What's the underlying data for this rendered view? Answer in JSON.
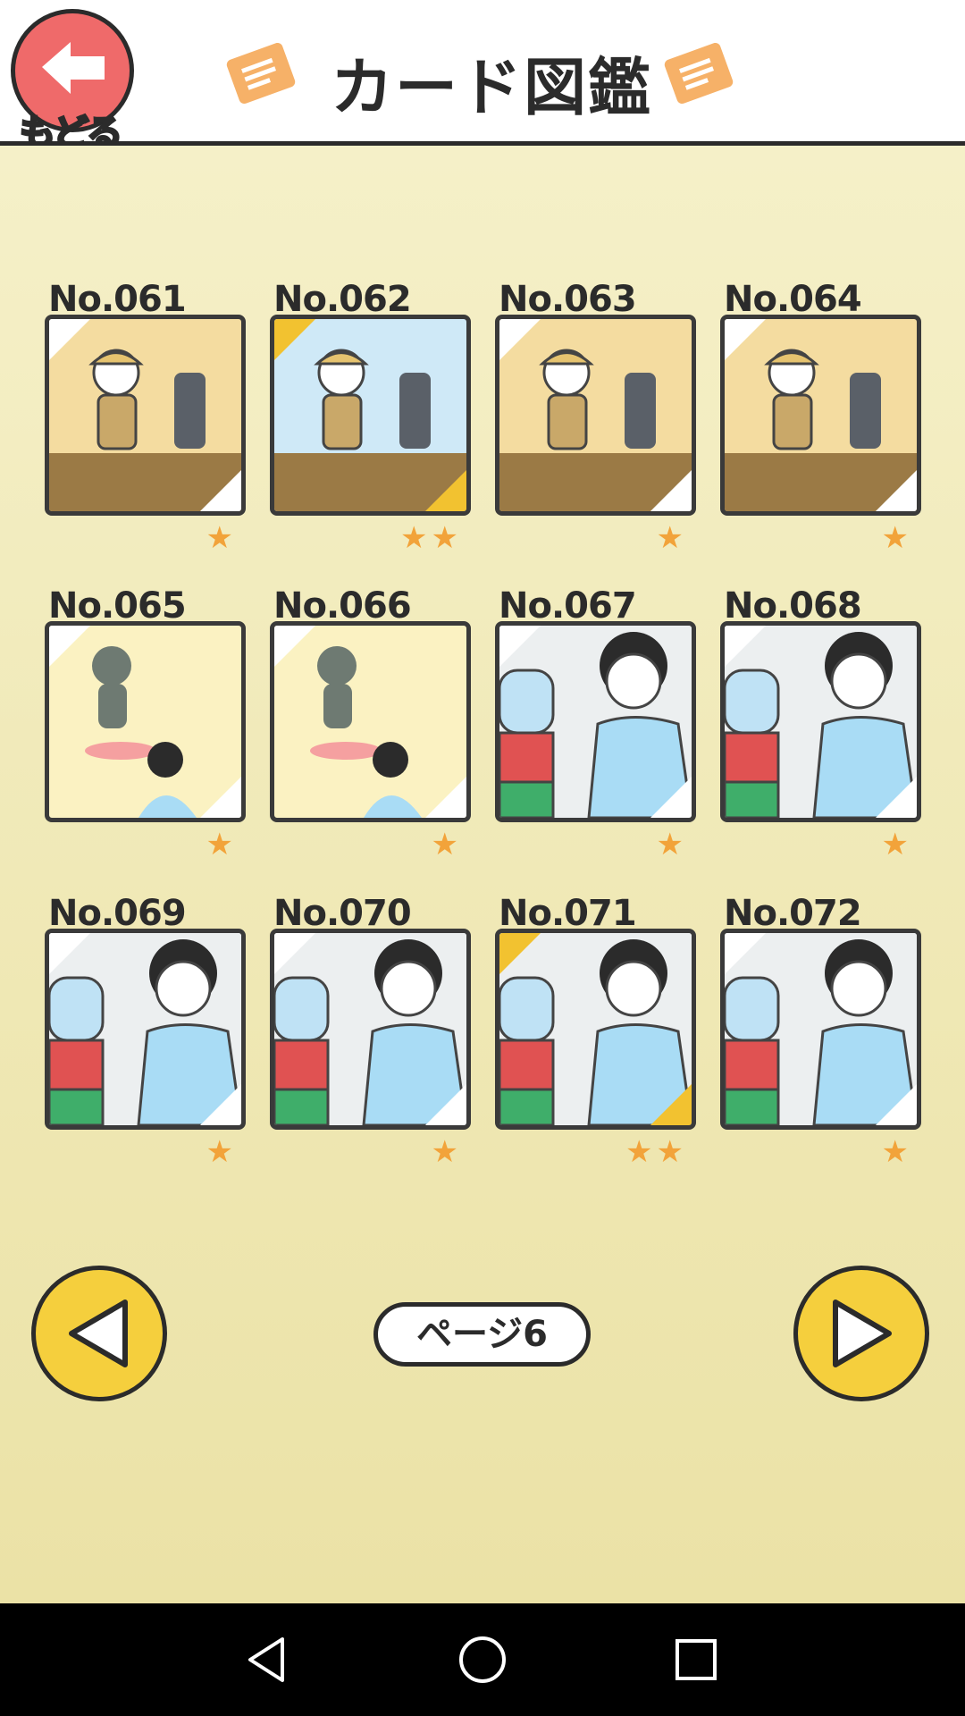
{
  "header": {
    "back_label": "もどる",
    "title": "カード図鑑"
  },
  "cards": [
    {
      "no": "No.061",
      "stars": "★",
      "rarity": "normal",
      "scene": "explorer-anubis"
    },
    {
      "no": "No.062",
      "stars": "★★",
      "rarity": "gold",
      "scene": "explorer-falling-water"
    },
    {
      "no": "No.063",
      "stars": "★",
      "rarity": "normal",
      "scene": "explorer-anubis-2"
    },
    {
      "no": "No.064",
      "stars": "★",
      "rarity": "normal",
      "scene": "explorer-wall"
    },
    {
      "no": "No.065",
      "stars": "★",
      "rarity": "normal",
      "scene": "statue-fountain"
    },
    {
      "no": "No.066",
      "stars": "★",
      "rarity": "normal",
      "scene": "statue-splash"
    },
    {
      "no": "No.067",
      "stars": "★",
      "rarity": "normal",
      "scene": "gacha-fish-bone"
    },
    {
      "no": "No.068",
      "stars": "★",
      "rarity": "normal",
      "scene": "gacha-doll"
    },
    {
      "no": "No.069",
      "stars": "★",
      "rarity": "normal",
      "scene": "gacha-spider"
    },
    {
      "no": "No.070",
      "stars": "★",
      "rarity": "normal",
      "scene": "gacha-crab"
    },
    {
      "no": "No.071",
      "stars": "★★",
      "rarity": "gold",
      "scene": "gacha-poop"
    },
    {
      "no": "No.072",
      "stars": "★",
      "rarity": "normal",
      "scene": "gacha-slime"
    }
  ],
  "pagination": {
    "page_label": "ページ6"
  },
  "colors": {
    "accent_yellow": "#f5cf3d",
    "back_red": "#ef6a6a",
    "star_orange": "#f2a33a",
    "icon_orange": "#f6b168"
  }
}
